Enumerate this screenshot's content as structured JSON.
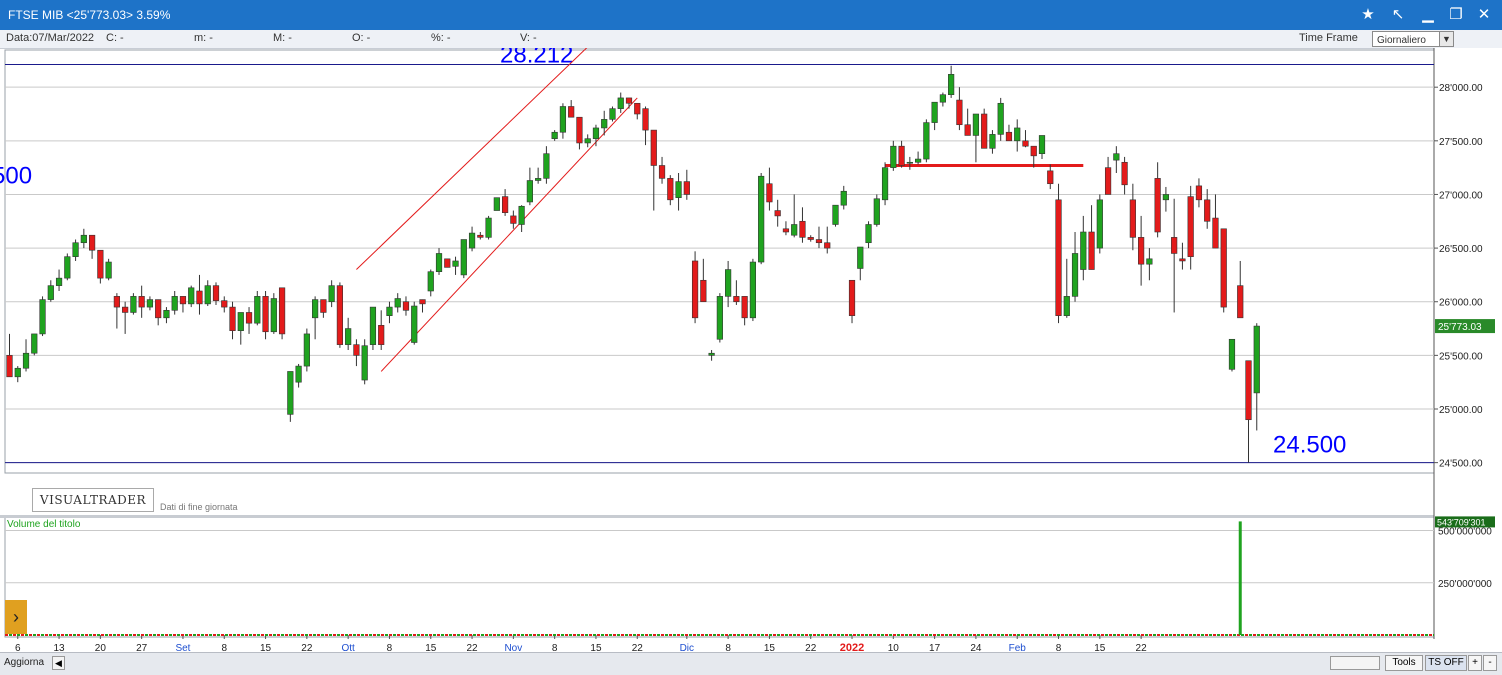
{
  "window": {
    "title": "FTSE MIB <25'773.03> 3.59%"
  },
  "toolbar_icons": [
    "star-icon",
    "drawing-tool-icon",
    "minimize-icon",
    "restore-icon",
    "close-icon"
  ],
  "infobar": {
    "data": "Data:07/Mar/2022",
    "c": "C: -",
    "m": "m: -",
    "M": "M: -",
    "o": "O: -",
    "pct": "%: -",
    "v": "V: -",
    "time_frame_label": "Time Frame",
    "time_frame_value": "Giornaliero"
  },
  "branding": {
    "logo": "VISUALTRADER",
    "note": "Dati di fine giornata"
  },
  "volume_pane": {
    "label": "Volume del titolo",
    "last_label": "543'709'301"
  },
  "bottom": {
    "aggiorna": "Aggiorna",
    "tools": "Tools",
    "ts_off": "TS OFF",
    "plus": "+",
    "minus": "-"
  },
  "colors": {
    "up": "#1fa31f",
    "down": "#e31b1b",
    "accent": "#1e73c8",
    "annotation": "#0000ff"
  },
  "chart_data": {
    "type": "candlestick",
    "price_axis": {
      "ticks": [
        24500,
        25000,
        25500,
        26000,
        26500,
        27000,
        27500,
        28000
      ],
      "tick_labels": [
        "24'500.00",
        "25'000.00",
        "25'500.00",
        "26'000.00",
        "26'500.00",
        "27'000.00",
        "27'500.00",
        "28'000.00"
      ],
      "ylim": [
        24450,
        28300
      ],
      "last_label": "25'773.03"
    },
    "volume_axis": {
      "ticks": [
        250000000,
        500000000
      ],
      "tick_labels": [
        "250'000'000",
        "500'000'000"
      ],
      "ylim": [
        0,
        560000000
      ]
    },
    "x_labels": [
      {
        "label": "6",
        "i": 1
      },
      {
        "label": "13",
        "i": 6
      },
      {
        "label": "20",
        "i": 11
      },
      {
        "label": "27",
        "i": 16
      },
      {
        "label": "Set",
        "i": 21,
        "month": true
      },
      {
        "label": "8",
        "i": 26
      },
      {
        "label": "15",
        "i": 31
      },
      {
        "label": "22",
        "i": 36
      },
      {
        "label": "Ott",
        "i": 41,
        "month": true
      },
      {
        "label": "8",
        "i": 46
      },
      {
        "label": "15",
        "i": 51
      },
      {
        "label": "22",
        "i": 56
      },
      {
        "label": "Nov",
        "i": 61,
        "month": true
      },
      {
        "label": "8",
        "i": 66
      },
      {
        "label": "15",
        "i": 71
      },
      {
        "label": "22",
        "i": 76
      },
      {
        "label": "Dic",
        "i": 82,
        "month": true
      },
      {
        "label": "8",
        "i": 87
      },
      {
        "label": "15",
        "i": 92
      },
      {
        "label": "22",
        "i": 97
      },
      {
        "label": "2022",
        "i": 102,
        "year": true
      },
      {
        "label": "10",
        "i": 107
      },
      {
        "label": "17",
        "i": 112
      },
      {
        "label": "24",
        "i": 117
      },
      {
        "label": "Feb",
        "i": 122,
        "month": true
      },
      {
        "label": "8",
        "i": 127
      },
      {
        "label": "15",
        "i": 132
      },
      {
        "label": "22",
        "i": 137
      }
    ],
    "annotations": {
      "resistance_text": "28.212",
      "support_text": "24.500",
      "left_text": "500"
    },
    "horizontal_levels": [
      28212,
      24500
    ],
    "neckline": 27270,
    "channel": {
      "upper": [
        [
          42,
          26300
        ],
        [
          71,
          28450
        ]
      ],
      "lower": [
        [
          45,
          25350
        ],
        [
          76,
          27900
        ]
      ]
    },
    "candles": [
      [
        25500,
        25700,
        25300,
        25300
      ],
      [
        25300,
        25400,
        25250,
        25380
      ],
      [
        25380,
        25650,
        25350,
        25520
      ],
      [
        25520,
        25700,
        25500,
        25700
      ],
      [
        25700,
        26050,
        25680,
        26020
      ],
      [
        26020,
        26200,
        26000,
        26150
      ],
      [
        26150,
        26300,
        26100,
        26220
      ],
      [
        26220,
        26450,
        26200,
        26420
      ],
      [
        26420,
        26580,
        26380,
        26550
      ],
      [
        26550,
        26680,
        26500,
        26620
      ],
      [
        26620,
        26500,
        26400,
        26480
      ],
      [
        26480,
        26400,
        26170,
        26220
      ],
      [
        26220,
        26400,
        26200,
        26370
      ],
      [
        26050,
        26080,
        25750,
        25950
      ],
      [
        25950,
        26000,
        25700,
        25900
      ],
      [
        25900,
        26080,
        25880,
        26050
      ],
      [
        26050,
        26150,
        25850,
        25950
      ],
      [
        25950,
        26050,
        25920,
        26020
      ],
      [
        26020,
        26000,
        25780,
        25850
      ],
      [
        25850,
        25950,
        25800,
        25920
      ],
      [
        25920,
        26100,
        25880,
        26050
      ],
      [
        26050,
        26000,
        25900,
        25980
      ],
      [
        25980,
        26150,
        25950,
        26130
      ],
      [
        26100,
        26250,
        25880,
        25980
      ],
      [
        25980,
        26200,
        25960,
        26150
      ],
      [
        26150,
        26180,
        25970,
        26010
      ],
      [
        26010,
        26050,
        25900,
        25950
      ],
      [
        25950,
        26000,
        25650,
        25730
      ],
      [
        25730,
        25850,
        25600,
        25900
      ],
      [
        25900,
        25950,
        25700,
        25800
      ],
      [
        25800,
        26100,
        25780,
        26050
      ],
      [
        26050,
        26100,
        25650,
        25720
      ],
      [
        25720,
        26080,
        25700,
        26030
      ],
      [
        26130,
        26100,
        25650,
        25700
      ],
      [
        24950,
        25000,
        24880,
        25350
      ],
      [
        25250,
        25420,
        25200,
        25400
      ],
      [
        25400,
        25750,
        25350,
        25700
      ],
      [
        25850,
        26050,
        25650,
        26020
      ],
      [
        26020,
        26000,
        25850,
        25900
      ],
      [
        26000,
        26200,
        25950,
        26150
      ],
      [
        26150,
        26180,
        25570,
        25600
      ],
      [
        25600,
        25850,
        25550,
        25750
      ],
      [
        25600,
        25650,
        25400,
        25500
      ],
      [
        25270,
        25650,
        25230,
        25590
      ],
      [
        25600,
        25950,
        25550,
        25950
      ],
      [
        25780,
        25920,
        25550,
        25600
      ],
      [
        25870,
        26000,
        25800,
        25950
      ],
      [
        25950,
        26080,
        25900,
        26030
      ],
      [
        26000,
        26050,
        25870,
        25920
      ],
      [
        25620,
        26000,
        25600,
        25960
      ],
      [
        26020,
        26000,
        25900,
        25980
      ],
      [
        26100,
        26300,
        26050,
        26280
      ],
      [
        26280,
        26500,
        26250,
        26450
      ],
      [
        26400,
        26380,
        26320,
        26320
      ],
      [
        26330,
        26420,
        26250,
        26380
      ],
      [
        26250,
        26550,
        26220,
        26580
      ],
      [
        26500,
        26700,
        26470,
        26640
      ],
      [
        26620,
        26650,
        26580,
        26600
      ],
      [
        26600,
        26800,
        26580,
        26780
      ],
      [
        26850,
        26950,
        26900,
        26970
      ],
      [
        26980,
        27050,
        26800,
        26830
      ],
      [
        26800,
        26850,
        26680,
        26730
      ],
      [
        26720,
        26900,
        26650,
        26890
      ],
      [
        26930,
        27250,
        26900,
        27130
      ],
      [
        27130,
        27250,
        27100,
        27150
      ],
      [
        27150,
        27450,
        27100,
        27380
      ],
      [
        27520,
        27600,
        27500,
        27580
      ],
      [
        27580,
        27850,
        27520,
        27820
      ],
      [
        27820,
        27880,
        27720,
        27720
      ],
      [
        27720,
        27650,
        27420,
        27480
      ],
      [
        27480,
        27560,
        27440,
        27520
      ],
      [
        27520,
        27650,
        27450,
        27620
      ],
      [
        27620,
        27780,
        27550,
        27700
      ],
      [
        27700,
        27820,
        27680,
        27800
      ],
      [
        27800,
        27950,
        27760,
        27900
      ],
      [
        27900,
        27880,
        27800,
        27850
      ],
      [
        27850,
        27800,
        27700,
        27750
      ],
      [
        27800,
        27820,
        27460,
        27600
      ],
      [
        27600,
        27550,
        26850,
        27270
      ],
      [
        27270,
        27350,
        27100,
        27150
      ],
      [
        27150,
        27180,
        26900,
        26950
      ],
      [
        26970,
        27200,
        26850,
        27120
      ],
      [
        27120,
        27230,
        26950,
        27000
      ],
      [
        26380,
        26470,
        25800,
        25850
      ],
      [
        26200,
        26400,
        26000,
        26000
      ],
      [
        25500,
        25550,
        25450,
        25520
      ],
      [
        25650,
        26080,
        25620,
        26050
      ],
      [
        26050,
        26380,
        25950,
        26300
      ],
      [
        26050,
        26200,
        25970,
        26000
      ],
      [
        26050,
        25950,
        25780,
        25850
      ],
      [
        25850,
        26400,
        25820,
        26370
      ],
      [
        26370,
        27200,
        26350,
        27170
      ],
      [
        27100,
        27250,
        26850,
        26930
      ],
      [
        26850,
        26950,
        26700,
        26800
      ],
      [
        26680,
        26750,
        26620,
        26650
      ],
      [
        26620,
        27000,
        26600,
        26720
      ],
      [
        26750,
        26880,
        26550,
        26600
      ],
      [
        26600,
        26620,
        26560,
        26580
      ],
      [
        26580,
        26700,
        26500,
        26550
      ],
      [
        26550,
        26700,
        26450,
        26500
      ],
      [
        26720,
        26900,
        26700,
        26900
      ],
      [
        26900,
        27080,
        26860,
        27030
      ],
      [
        26200,
        26000,
        25800,
        25870
      ],
      [
        26310,
        26500,
        26200,
        26510
      ],
      [
        26550,
        26750,
        26500,
        26720
      ],
      [
        26720,
        27000,
        26700,
        26960
      ],
      [
        26950,
        27300,
        26900,
        27250
      ],
      [
        27250,
        27500,
        27220,
        27450
      ],
      [
        27450,
        27500,
        27250,
        27270
      ],
      [
        27300,
        27350,
        27230,
        27300
      ],
      [
        27300,
        27400,
        27280,
        27330
      ],
      [
        27330,
        27700,
        27300,
        27670
      ],
      [
        27670,
        27850,
        27600,
        27860
      ],
      [
        27860,
        27950,
        27820,
        27930
      ],
      [
        27930,
        28200,
        27900,
        28120
      ],
      [
        27880,
        28000,
        27600,
        27650
      ],
      [
        27650,
        27800,
        27550,
        27550
      ],
      [
        27550,
        27750,
        27300,
        27750
      ],
      [
        27750,
        27800,
        27500,
        27430
      ],
      [
        27430,
        27600,
        27380,
        27560
      ],
      [
        27560,
        27900,
        27500,
        27850
      ],
      [
        27580,
        27650,
        27500,
        27500
      ],
      [
        27500,
        27700,
        27400,
        27620
      ],
      [
        27500,
        27600,
        27440,
        27450
      ],
      [
        27450,
        27350,
        27250,
        27360
      ],
      [
        27380,
        27550,
        27330,
        27550
      ],
      [
        27220,
        27280,
        27050,
        27100
      ],
      [
        26950,
        27100,
        25800,
        25870
      ],
      [
        25870,
        26400,
        25850,
        26050
      ],
      [
        26050,
        26650,
        26000,
        26450
      ],
      [
        26300,
        26800,
        26200,
        26650
      ],
      [
        26650,
        26900,
        26500,
        26300
      ],
      [
        26500,
        27000,
        26450,
        26950
      ],
      [
        27250,
        27350,
        27000,
        27000
      ],
      [
        27320,
        27450,
        27200,
        27380
      ],
      [
        27300,
        27350,
        27000,
        27090
      ],
      [
        26950,
        27100,
        26480,
        26600
      ],
      [
        26600,
        26800,
        26150,
        26350
      ],
      [
        26350,
        26500,
        26200,
        26400
      ],
      [
        27150,
        27300,
        26600,
        26650
      ],
      [
        26950,
        27070,
        26840,
        27000
      ],
      [
        26600,
        26960,
        25900,
        26450
      ],
      [
        26400,
        26550,
        26300,
        26380
      ],
      [
        26980,
        27080,
        26300,
        26420
      ],
      [
        27080,
        27150,
        26880,
        26950
      ],
      [
        26950,
        27050,
        26680,
        26750
      ],
      [
        26780,
        27000,
        26500,
        26500
      ],
      [
        26680,
        26650,
        25900,
        25950
      ],
      [
        25370,
        25650,
        25350,
        25650
      ],
      [
        26150,
        26380,
        26000,
        25850
      ],
      [
        25450,
        25450,
        24500,
        24900
      ],
      [
        25150,
        25800,
        24800,
        25773
      ]
    ],
    "volume": {
      "last_index": 149,
      "last_value": 543709301
    }
  }
}
